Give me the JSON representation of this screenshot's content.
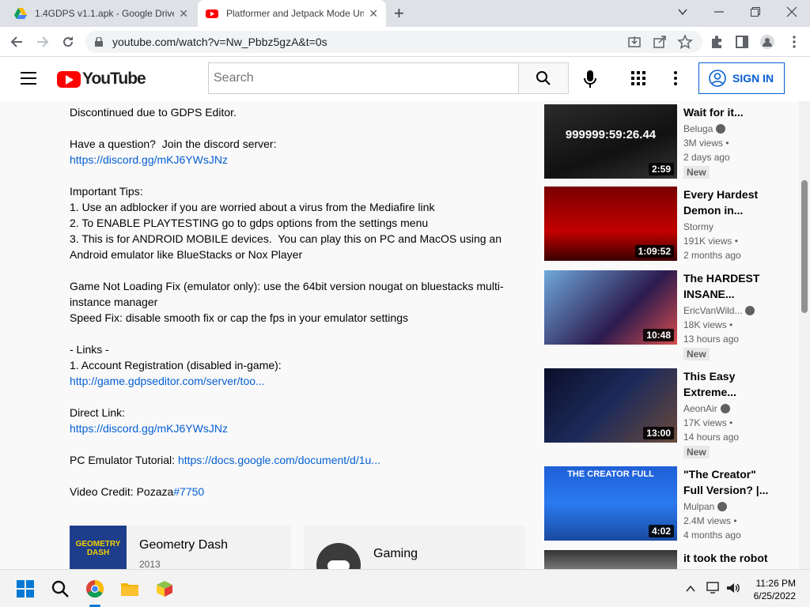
{
  "browser": {
    "tabs": [
      {
        "title": "1.4GDPS v1.1.apk - Google Drive",
        "close": "✕"
      },
      {
        "title": "Platformer and Jetpack Mode Un",
        "close": "✕"
      }
    ],
    "new_tab": "+",
    "url": "youtube.com/watch?v=Nw_Pbbz5gzA&t=0s"
  },
  "header": {
    "logo": "YouTube",
    "search_placeholder": "Search",
    "sign_in": "SIGN IN"
  },
  "description": {
    "lines": [
      {
        "text": "Discontinued due to GDPS Editor."
      },
      {
        "text": ""
      },
      {
        "text": "Have a question?  Join the discord server:"
      },
      {
        "link": "https://discord.gg/mKJ6YWsJNz"
      },
      {
        "text": ""
      },
      {
        "text": "Important Tips:"
      },
      {
        "text": "1. Use an adblocker if you are worried about a virus from the Mediafire link"
      },
      {
        "text": "2. To ENABLE PLAYTESTING go to gdps options from the settings menu"
      },
      {
        "text": "3. This is for ANDROID MOBILE devices.  You can play this on PC and MacOS using an"
      },
      {
        "text": "Android emulator like BlueStacks or Nox Player"
      },
      {
        "text": ""
      },
      {
        "text": "Game Not Loading Fix (emulator only): use the 64bit version nougat on bluestacks multi-"
      },
      {
        "text": "instance manager"
      },
      {
        "text": "Speed Fix: disable smooth fix or cap the fps in your emulator settings"
      },
      {
        "text": ""
      },
      {
        "text": "- Links -"
      },
      {
        "text": "1. Account Registration (disabled in-game):"
      },
      {
        "link": "http://game.gdpseditor.com/server/too..."
      },
      {
        "text": ""
      },
      {
        "text": "Direct Link:"
      },
      {
        "link": "https://discord.gg/mKJ6YWsJNz"
      },
      {
        "text": ""
      },
      {
        "text": "PC Emulator Tutorial: ",
        "link": "https://docs.google.com/document/d/1u..."
      },
      {
        "text": ""
      },
      {
        "text": "Video Credit: Pozaza",
        "link": "#7750"
      }
    ]
  },
  "cards": [
    {
      "name": "Geometry Dash",
      "sub": "2013",
      "thumb_text": "GEOMETRY DASH"
    },
    {
      "name": "Gaming"
    }
  ],
  "recommendations": [
    {
      "title": "Wait for it...",
      "channel": "Beluga",
      "verified": true,
      "views": "3M views •",
      "age": "2 days ago",
      "badge": "New",
      "duration": "2:59",
      "thumb_text": "999999:59:26.44"
    },
    {
      "title": "Every Hardest Demon in...",
      "channel": "Stormy",
      "verified": false,
      "views": "191K views •",
      "age": "2 months ago",
      "duration": "1:09:52"
    },
    {
      "title": "The HARDEST INSANE...",
      "channel": "EricVanWild...",
      "verified": true,
      "views": "18K views •",
      "age": "13 hours ago",
      "badge": "New",
      "duration": "10:48"
    },
    {
      "title": "This Easy Extreme...",
      "channel": "AeonAir",
      "verified": true,
      "views": "17K views •",
      "age": "14 hours ago",
      "badge": "New",
      "duration": "13:00"
    },
    {
      "title": "\"The Creator\" Full Version? |...",
      "channel": "Mulpan",
      "verified": true,
      "views": "2.4M views •",
      "age": "4 months ago",
      "duration": "4:02",
      "thumb_text": "THE CREATOR FULL"
    },
    {
      "title": "it took the robot"
    }
  ],
  "taskbar": {
    "time": "11:26 PM",
    "date": "6/25/2022"
  }
}
